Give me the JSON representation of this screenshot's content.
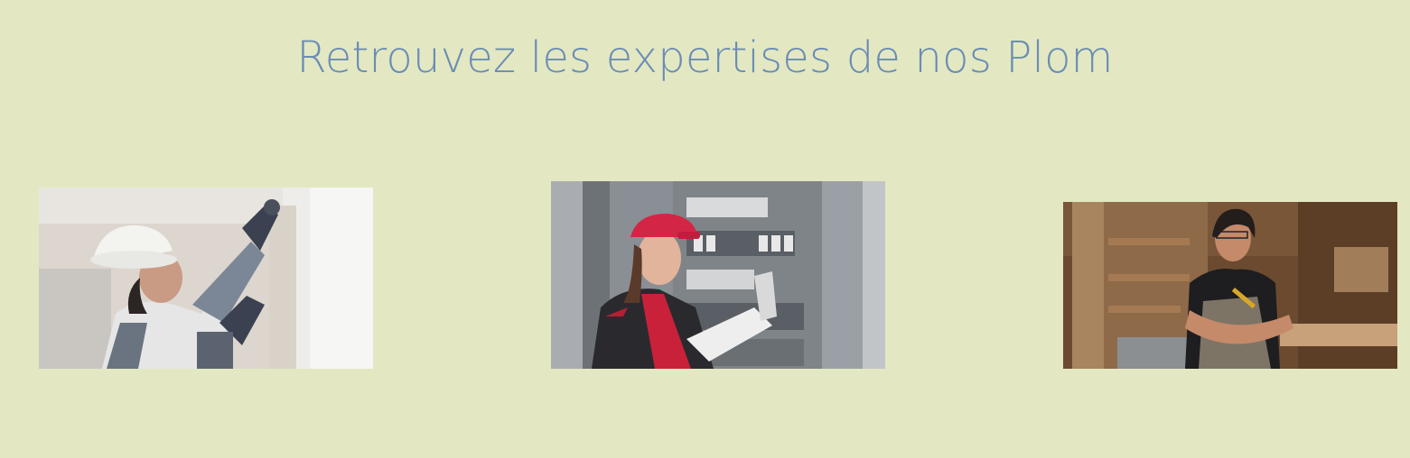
{
  "section": {
    "title": "Retrouvez les expertises de nos Plom"
  },
  "colors": {
    "background": "#e3e8c2",
    "title": "#6b8db4"
  },
  "gallery": [
    {
      "icon": "painter-photo"
    },
    {
      "icon": "electrician-photo"
    },
    {
      "icon": "carpenter-photo"
    }
  ]
}
